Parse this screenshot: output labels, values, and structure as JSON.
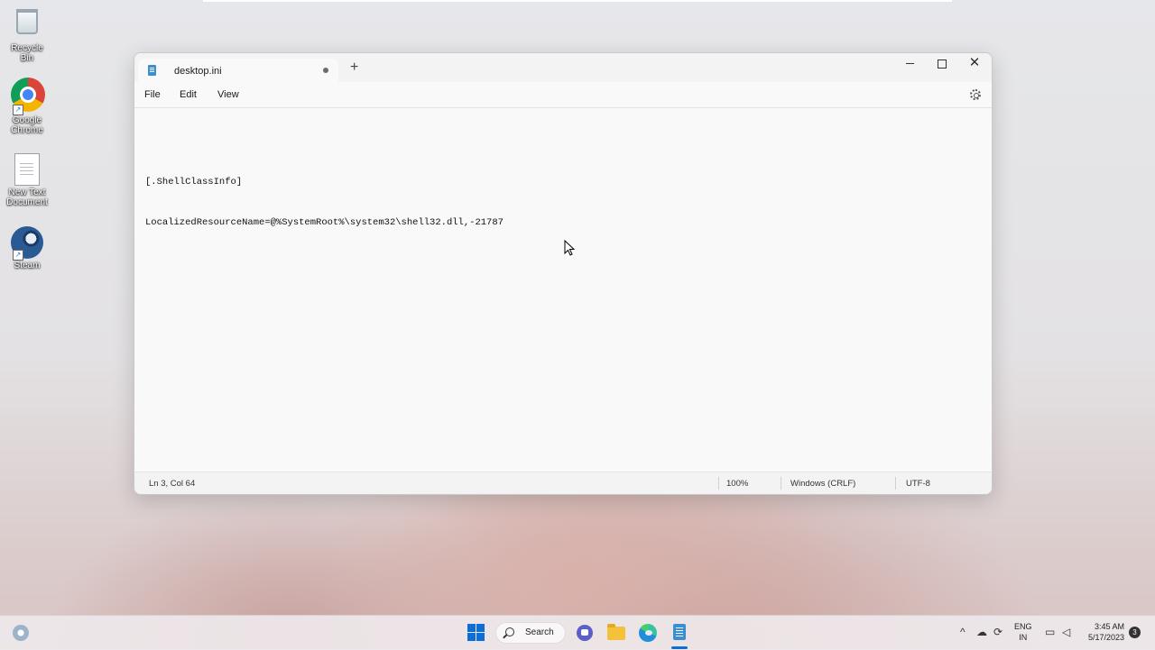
{
  "desktop": {
    "icons": [
      {
        "label": "Recycle Bin"
      },
      {
        "label": "Google Chrome"
      },
      {
        "label": "New Text Document"
      },
      {
        "label": "Steam"
      }
    ]
  },
  "window": {
    "tab_title": "desktop.ini",
    "new_tab_label": "+",
    "controls": {
      "minimize": "—",
      "maximize": "",
      "close": "✕"
    },
    "menu": {
      "file": "File",
      "edit": "Edit",
      "view": "View"
    },
    "editor": {
      "lines": [
        "",
        "[.ShellClassInfo]",
        "LocalizedResourceName=@%SystemRoot%\\system32\\shell32.dll,-21787"
      ]
    },
    "status": {
      "position": "Ln 3, Col 64",
      "zoom": "100%",
      "line_ending": "Windows (CRLF)",
      "encoding": "UTF-8"
    }
  },
  "taskbar": {
    "search_label": "Search",
    "language": {
      "line1": "ENG",
      "line2": "IN"
    },
    "clock": {
      "time": "3:45 AM",
      "date": "5/17/2023"
    },
    "notification_count": "3"
  },
  "colors": {
    "accent": "#0d6fd6",
    "notepad_blue": "#3a8fd1"
  }
}
